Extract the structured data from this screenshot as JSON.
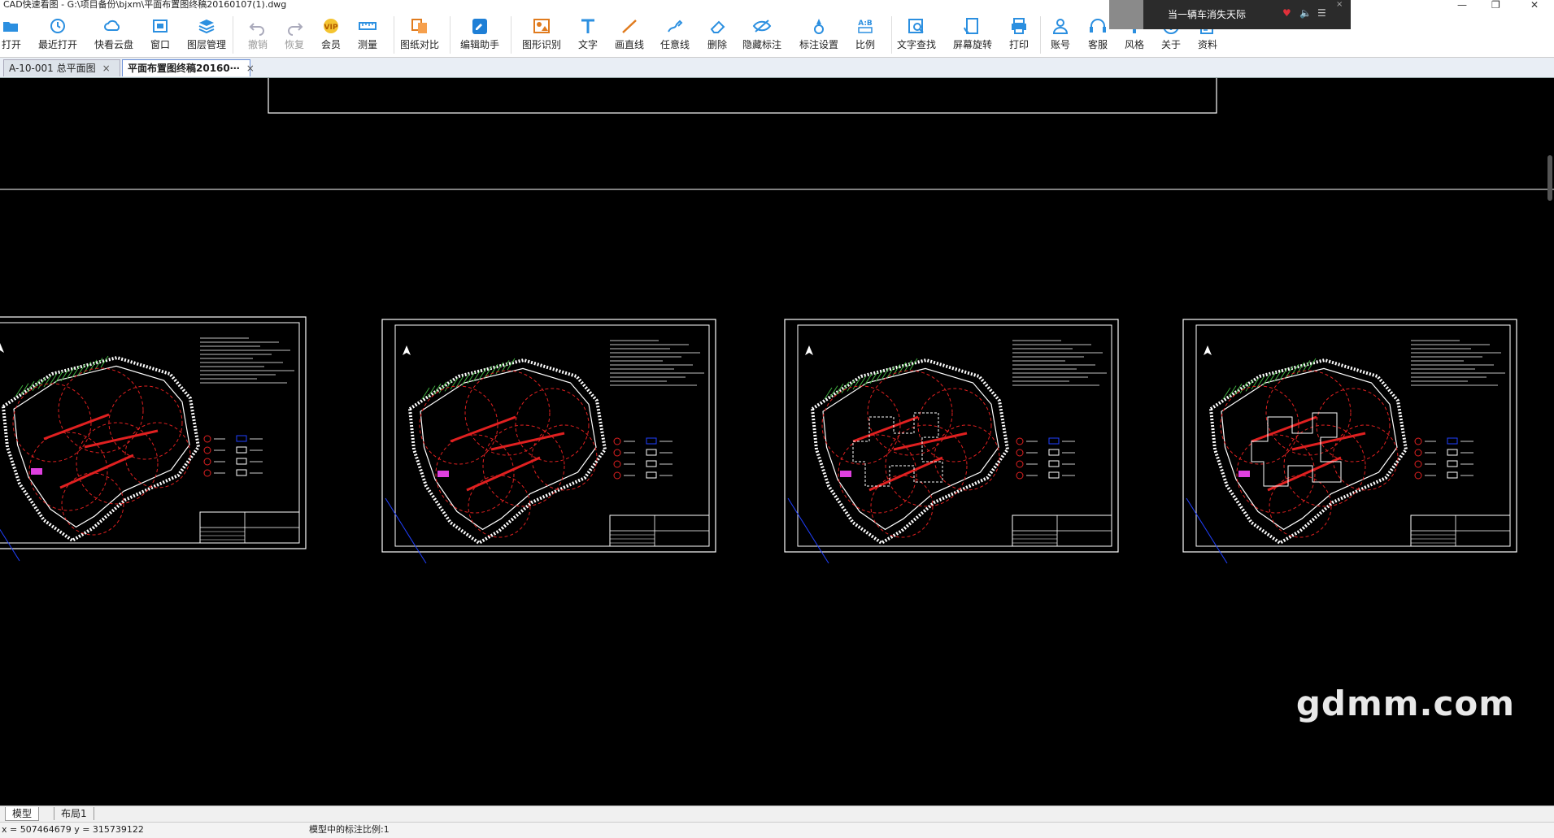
{
  "window": {
    "title": "CAD快速看图 - G:\\项目备份\\bjxm\\平面布置图终稿20160107(1).dwg",
    "controls": [
      "—",
      "❐",
      "✕"
    ]
  },
  "toolbar": {
    "items": [
      {
        "label": "打开",
        "icon": "folder-open-icon",
        "enabled": true
      },
      {
        "label": "最近打开",
        "icon": "clock-icon",
        "enabled": true
      },
      {
        "label": "快看云盘",
        "icon": "cloud-icon",
        "enabled": true
      },
      {
        "label": "窗口",
        "icon": "window-icon",
        "enabled": true
      },
      {
        "label": "图层管理",
        "icon": "layers-icon",
        "enabled": true
      },
      {
        "label": "撤销",
        "icon": "undo-icon",
        "enabled": false
      },
      {
        "label": "恢复",
        "icon": "redo-icon",
        "enabled": false
      },
      {
        "label": "会员",
        "icon": "vip-icon",
        "enabled": true
      },
      {
        "label": "测量",
        "icon": "ruler-icon",
        "enabled": true
      },
      {
        "label": "图纸对比",
        "icon": "compare-icon",
        "enabled": true
      },
      {
        "label": "编辑助手",
        "icon": "edit-assistant-icon",
        "enabled": true
      },
      {
        "label": "图形识别",
        "icon": "shape-recognition-icon",
        "enabled": true
      },
      {
        "label": "文字",
        "icon": "text-icon",
        "enabled": true
      },
      {
        "label": "画直线",
        "icon": "line-icon",
        "enabled": true
      },
      {
        "label": "任意线",
        "icon": "freehand-icon",
        "enabled": true
      },
      {
        "label": "删除",
        "icon": "eraser-icon",
        "enabled": true
      },
      {
        "label": "隐藏标注",
        "icon": "eye-hide-icon",
        "enabled": true
      },
      {
        "label": "标注设置",
        "icon": "annotation-settings-icon",
        "enabled": true
      },
      {
        "label": "比例",
        "icon": "scale-icon",
        "enabled": true
      },
      {
        "label": "文字查找",
        "icon": "text-search-icon",
        "enabled": true
      },
      {
        "label": "屏幕旋转",
        "icon": "rotate-screen-icon",
        "enabled": true
      },
      {
        "label": "打印",
        "icon": "printer-icon",
        "enabled": true
      },
      {
        "label": "账号",
        "icon": "user-icon",
        "enabled": true
      },
      {
        "label": "客服",
        "icon": "headset-icon",
        "enabled": true
      },
      {
        "label": "风格",
        "icon": "style-icon",
        "enabled": true
      },
      {
        "label": "关于",
        "icon": "info-icon",
        "enabled": true
      },
      {
        "label": "资料",
        "icon": "docs-icon",
        "enabled": true
      }
    ]
  },
  "tabs": [
    {
      "label": "A-10-001 总平面图",
      "active": false
    },
    {
      "label": "平面布置图终稿20160⋯",
      "active": true
    }
  ],
  "music_widget": {
    "song": "当一辆车消失天际"
  },
  "layout_tabs": [
    {
      "label": "模型",
      "active": true
    },
    {
      "label": "布局1",
      "active": false
    }
  ],
  "status": {
    "coords": "x = 507464679  y = 315739122",
    "scale_text": "模型中的标注比例:1"
  },
  "watermark": "gdmm.com",
  "colors": {
    "canvas": "#000000",
    "drawing_line": "#ffffff",
    "red_circle": "#e02020",
    "green_hatch": "#3fae3f",
    "blue_line": "#2040ff",
    "magenta": "#e040e0",
    "accent_blue": "#1e7fd6"
  }
}
